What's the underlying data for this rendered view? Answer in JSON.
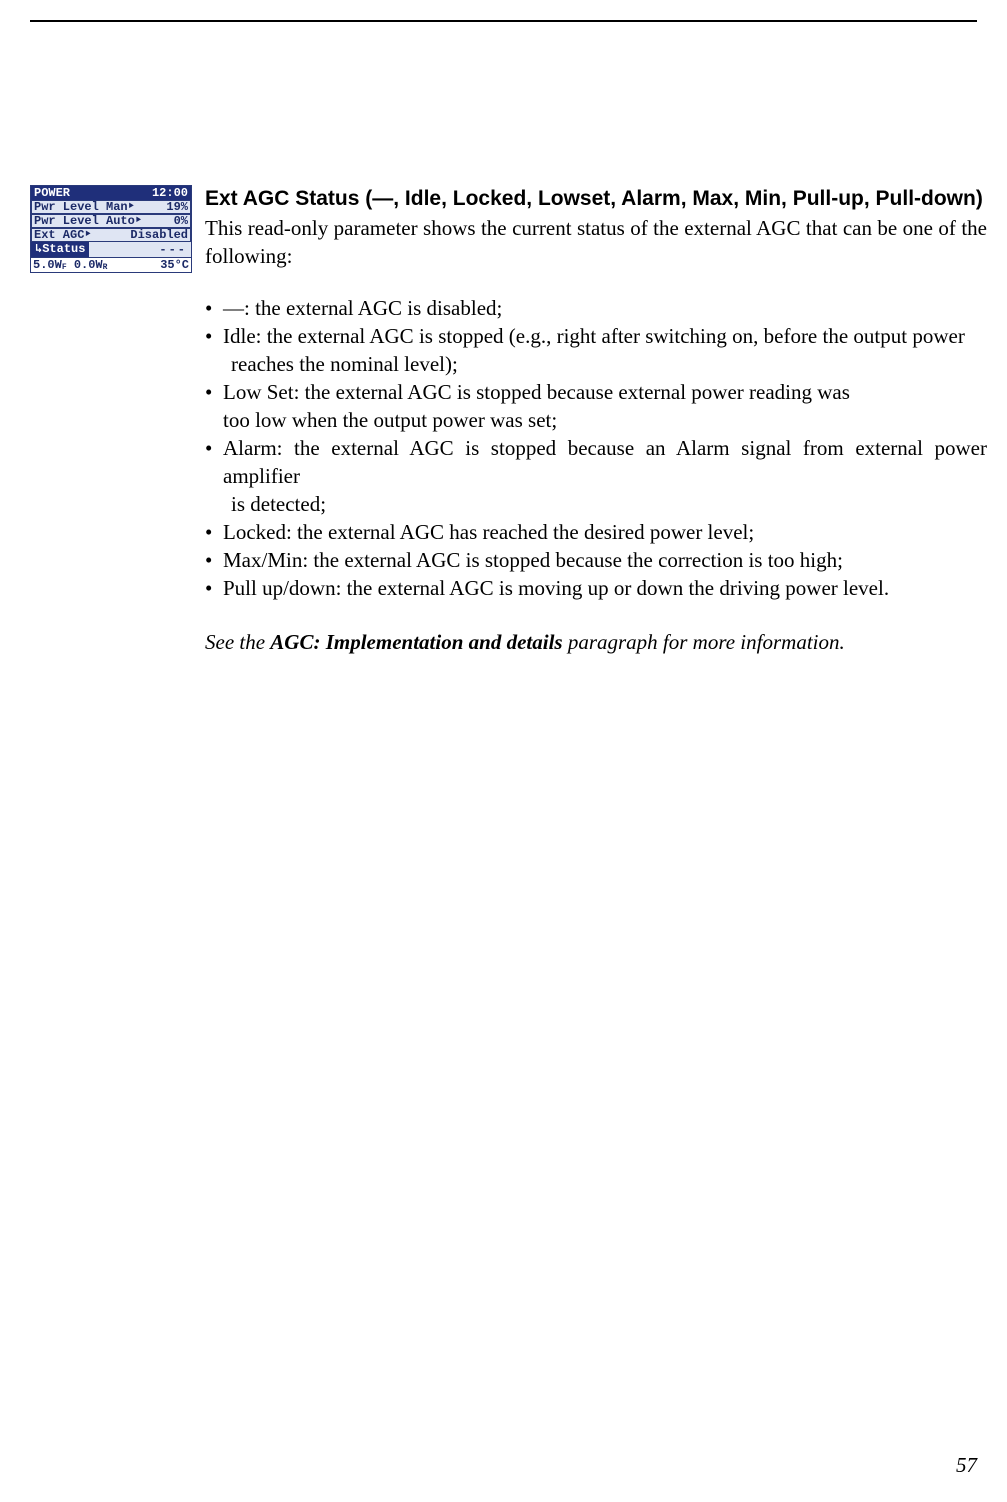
{
  "lcd": {
    "title_left": "POWER",
    "title_right": "12:00",
    "row1_left": "Pwr Level Man‣",
    "row1_right": "19%",
    "row2_left": "Pwr Level Auto‣",
    "row2_right": "0%",
    "row3_left": "Ext AGC‣",
    "row3_right": "Disabled",
    "status_tab": "↳Status",
    "status_right": "---",
    "footer_left": "5.0W",
    "footer_left_sub": "F",
    "footer_mid": "0.0W",
    "footer_mid_sub": "R",
    "footer_right": "35°C"
  },
  "heading": "Ext AGC Status (—, Idle, Locked, Lowset, Alarm, Max, Min, Pull-up, Pull-down)",
  "intro": "This read-only parameter shows the current status of the external AGC that can be one of the following:",
  "bullets": [
    {
      "line1": "—: the external AGC is disabled;",
      "line2": ""
    },
    {
      "line1": "Idle: the external AGC is stopped (e.g., right after switching on, before the output power",
      "line2": "reaches the nominal level);"
    },
    {
      "line1": "Low Set: the external AGC is stopped because external power reading was",
      "line2": "too low when the output power was set;"
    },
    {
      "line1": "Alarm: the external AGC is stopped because an Alarm signal from external power amplifier",
      "line2": "is detected;"
    },
    {
      "line1": "Locked: the external AGC has reached the desired power level;",
      "line2": ""
    },
    {
      "line1": "Max/Min: the external AGC is stopped because the correction is too high;",
      "line2": ""
    },
    {
      "line1": "Pull up/down: the external AGC is moving up or down the driving power level.",
      "line2": ""
    }
  ],
  "seealso_pre": "See the ",
  "seealso_strong": "AGC: Implementation and details",
  "seealso_post": " paragraph for more information.",
  "page_number": "57",
  "bullet_glyph": "•"
}
